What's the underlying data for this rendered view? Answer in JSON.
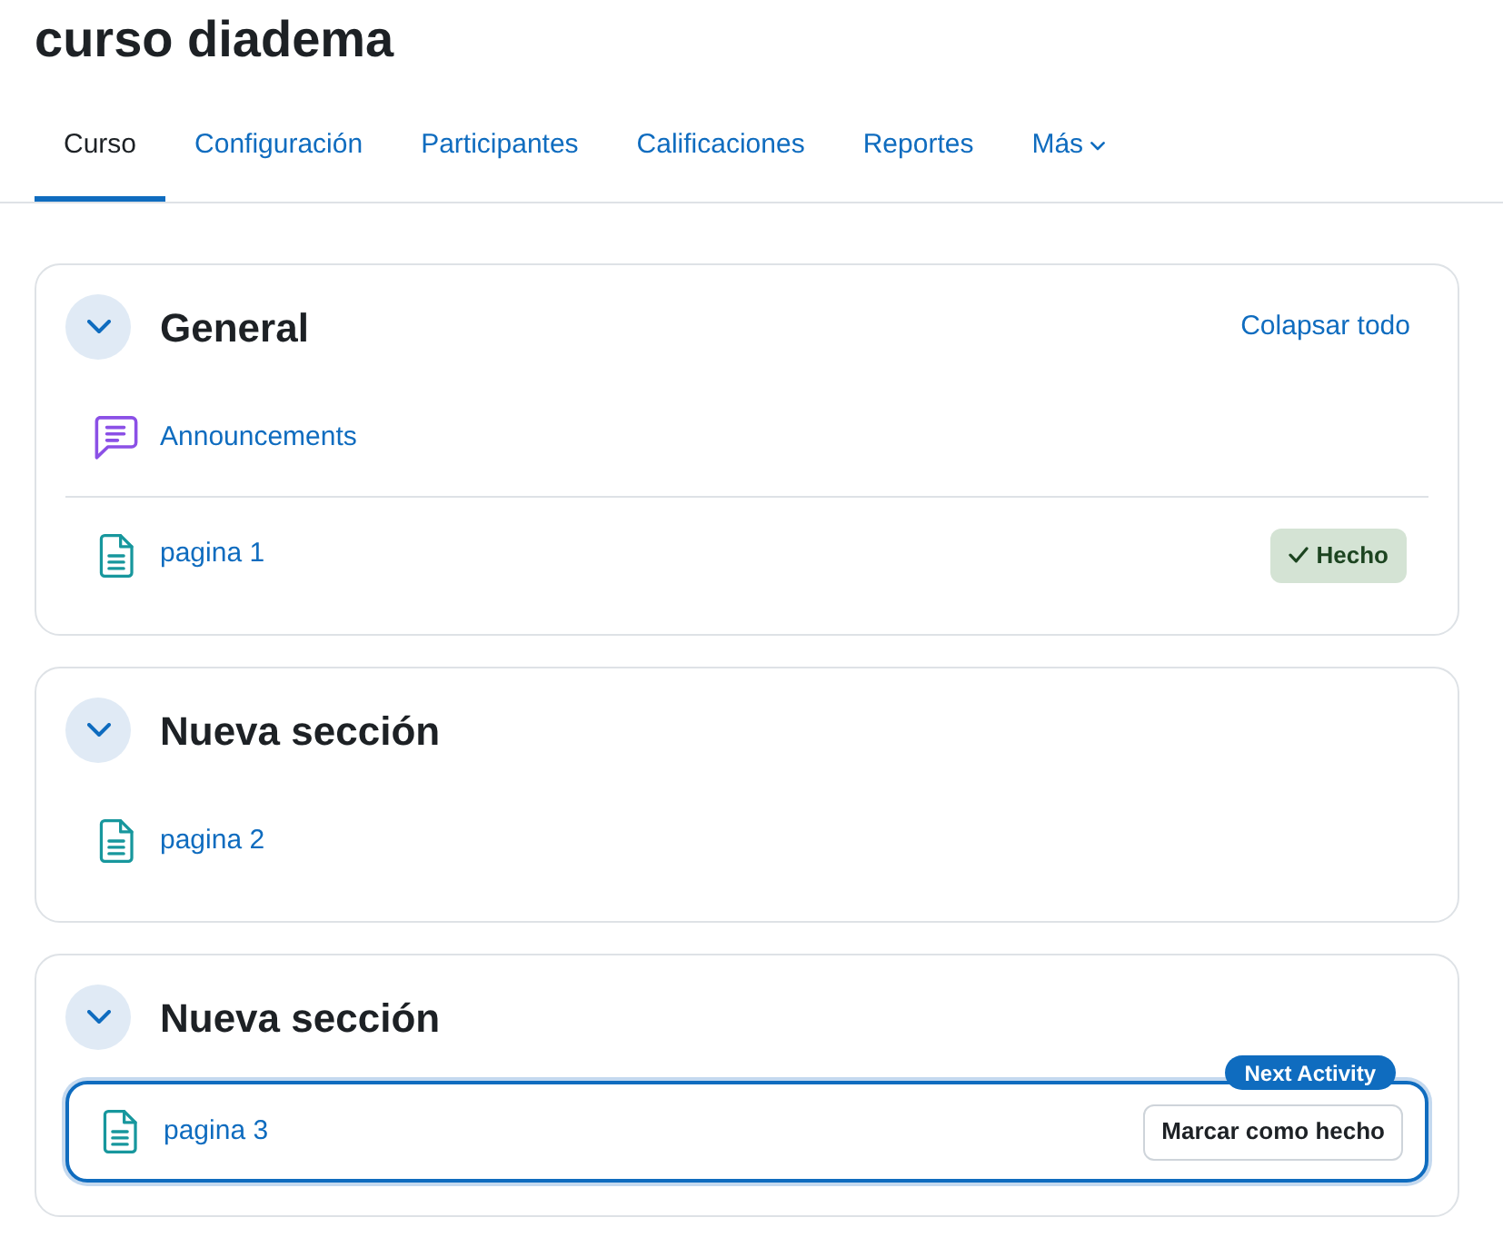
{
  "page_title": "curso diadema",
  "tabs": [
    {
      "label": "Curso",
      "selected": true,
      "kind": "link"
    },
    {
      "label": "Configuración",
      "selected": false,
      "kind": "link"
    },
    {
      "label": "Participantes",
      "selected": false,
      "kind": "link"
    },
    {
      "label": "Calificaciones",
      "selected": false,
      "kind": "link"
    },
    {
      "label": "Reportes",
      "selected": false,
      "kind": "link"
    },
    {
      "label": "Más",
      "selected": false,
      "kind": "dropdown"
    }
  ],
  "sections": [
    {
      "title": "General",
      "expanded": true,
      "header_link": "Colapsar todo",
      "activities": [
        {
          "kind": "forum",
          "name": "Announcements"
        },
        {
          "kind": "page",
          "name": "pagina 1",
          "completion": {
            "kind": "done",
            "label": "Hecho"
          }
        }
      ]
    },
    {
      "title": "Nueva sección",
      "expanded": true,
      "activities": [
        {
          "kind": "page",
          "name": "pagina 2"
        }
      ]
    },
    {
      "title": "Nueva sección",
      "expanded": true,
      "activities": [
        {
          "kind": "page",
          "name": "pagina 3",
          "badge": "Next Activity",
          "completion": {
            "kind": "manual",
            "label": "Marcar como hecho"
          }
        }
      ]
    }
  ]
}
